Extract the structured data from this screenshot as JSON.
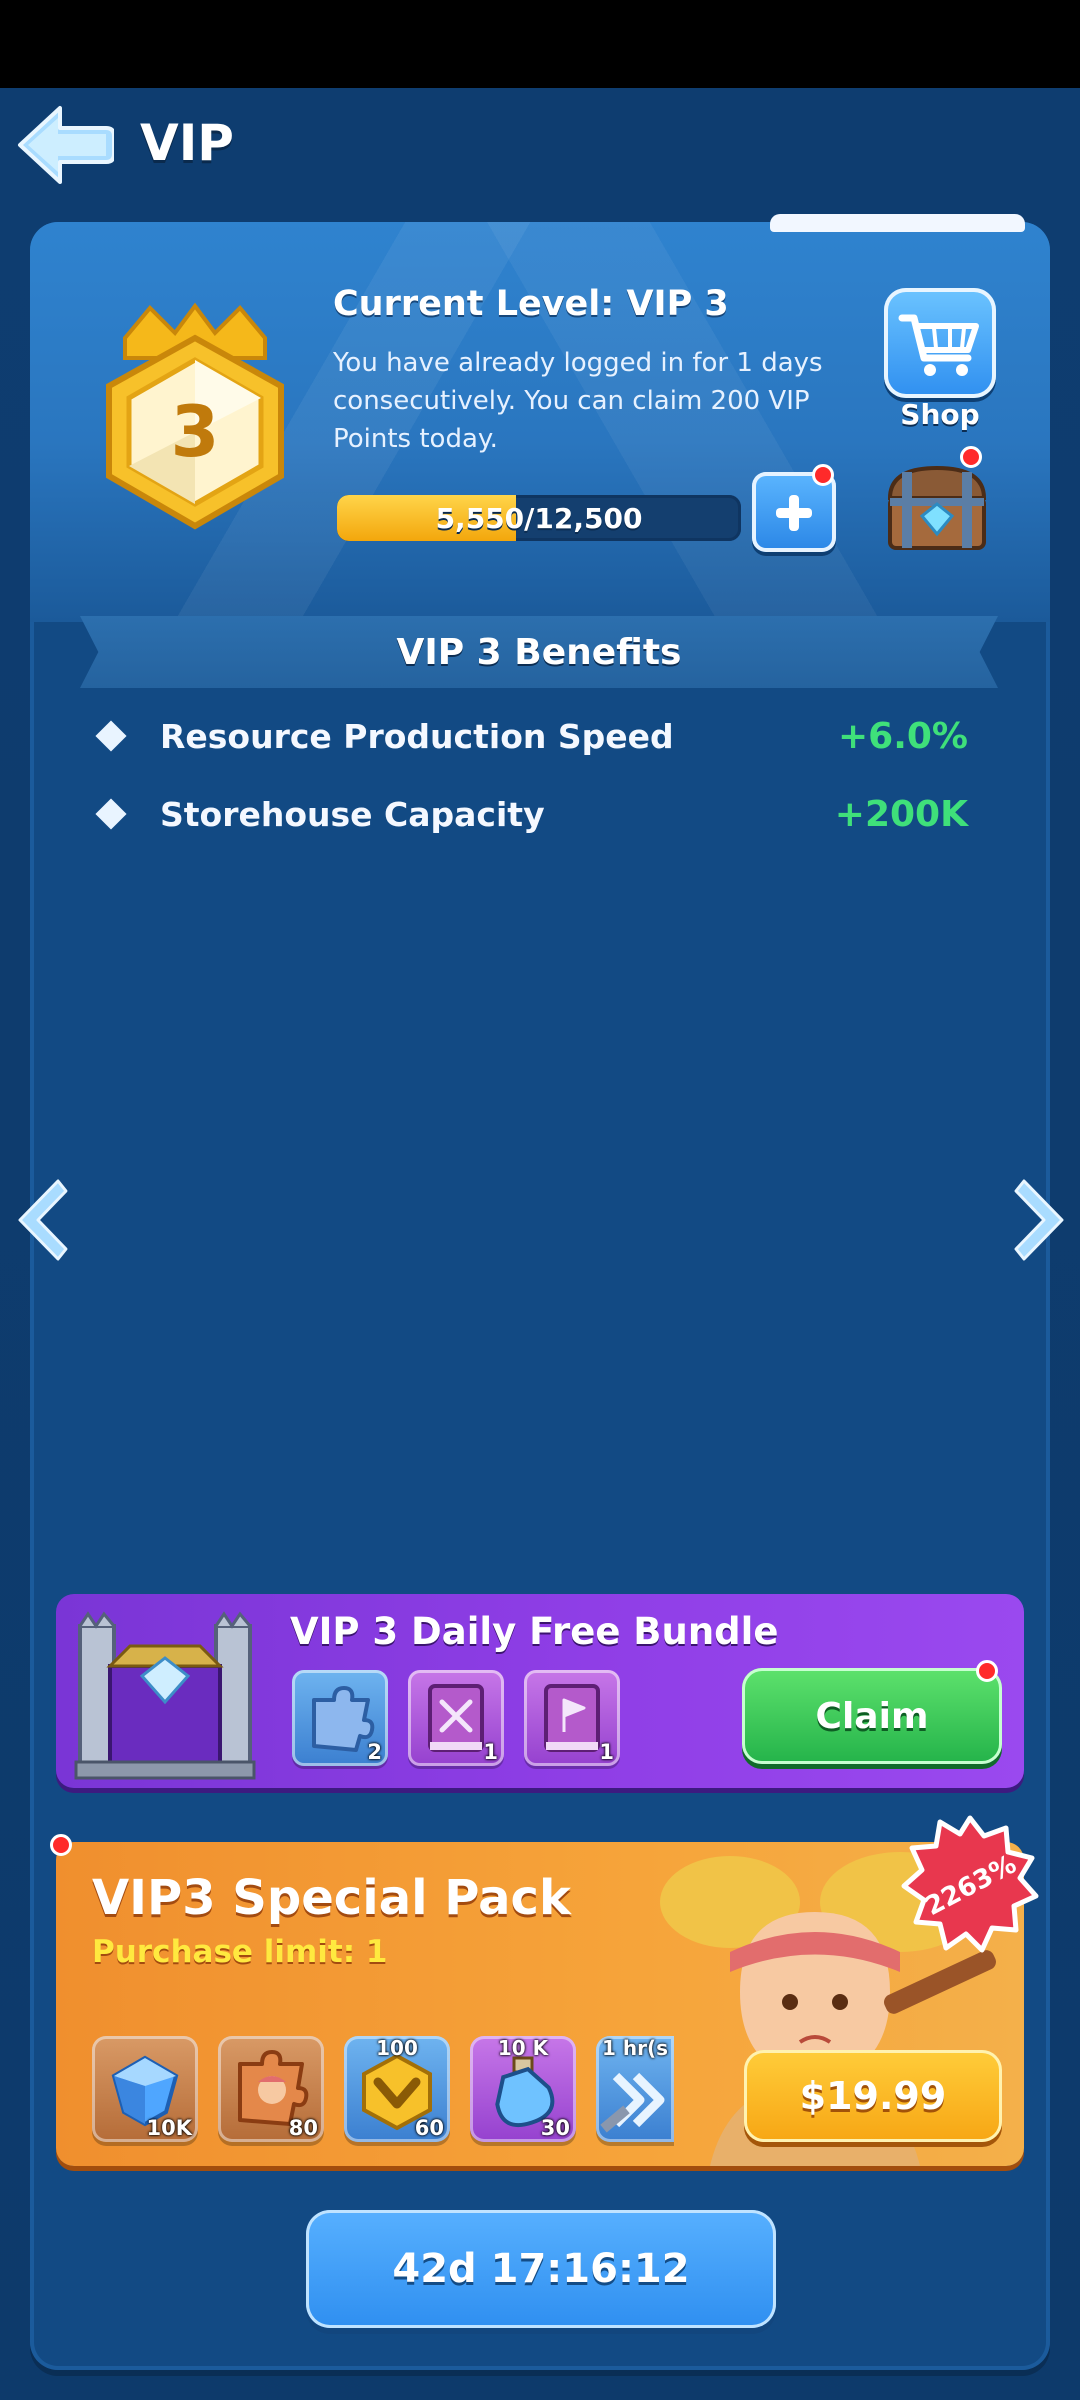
{
  "header": {
    "title": "VIP"
  },
  "status": {
    "current_level_label": "Current Level: VIP 3",
    "badge_level": "3",
    "login_message": "You have already logged in for 1 days consecutively. You can claim 200 VIP Points today.",
    "progress": {
      "current": 5550,
      "max": 12500,
      "text": "5,550/12,500"
    },
    "shop_label": "Shop"
  },
  "benefits": {
    "title": "VIP 3 Benefits",
    "items": [
      {
        "label": "Resource Production Speed",
        "value": "+6.0%"
      },
      {
        "label": "Storehouse Capacity",
        "value": "+200K"
      }
    ]
  },
  "daily_bundle": {
    "title": "VIP 3 Daily Free Bundle",
    "items": [
      {
        "icon": "puzzle-piece-icon",
        "qty": "2"
      },
      {
        "icon": "skill-book-sword-icon",
        "qty": "1"
      },
      {
        "icon": "skill-book-flag-icon",
        "qty": "1"
      }
    ],
    "claim_label": "Claim"
  },
  "special_pack": {
    "title": "VIP3 Special Pack",
    "limit": "Purchase limit: 1",
    "discount": "2263%",
    "items": [
      {
        "icon": "gem-icon",
        "qty": "10K",
        "top": ""
      },
      {
        "icon": "hero-puzzle-icon",
        "qty": "80",
        "top": ""
      },
      {
        "icon": "gold-chevron-icon",
        "qty": "60",
        "top": "100"
      },
      {
        "icon": "exp-potion-icon",
        "qty": "30",
        "top": "10 K"
      },
      {
        "icon": "speedup-icon",
        "qty": "",
        "top": "1 hr(s"
      }
    ],
    "price": "$19.99"
  },
  "timer": "42d 17:16:12",
  "colors": {
    "background": "#0f3f73",
    "benefit_value": "#3fe07a",
    "claim_green": "#24b34a",
    "price_orange": "#f7a614",
    "bundle_purple": "#8f3ee6"
  }
}
